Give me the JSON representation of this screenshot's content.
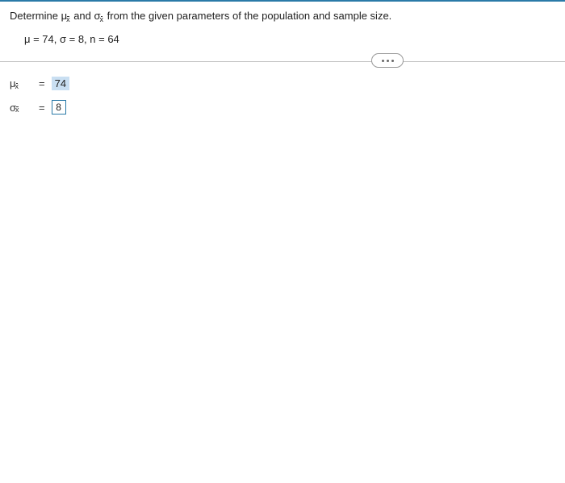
{
  "prompt": {
    "prefix": "Determine ",
    "mu_base": "μ",
    "mu_sub": "x",
    "mid": " and ",
    "sigma_base": "σ",
    "sigma_sub": "x",
    "suffix": " from the given parameters of the population and sample size."
  },
  "parameters_text": "μ = 74, σ = 8, n = 64",
  "answers": {
    "mu": {
      "label_base": "μ",
      "label_sub": "x",
      "eq": "=",
      "value": "74"
    },
    "sigma": {
      "label_base": "σ",
      "label_sub": "x",
      "eq": "=",
      "value": "8"
    }
  }
}
